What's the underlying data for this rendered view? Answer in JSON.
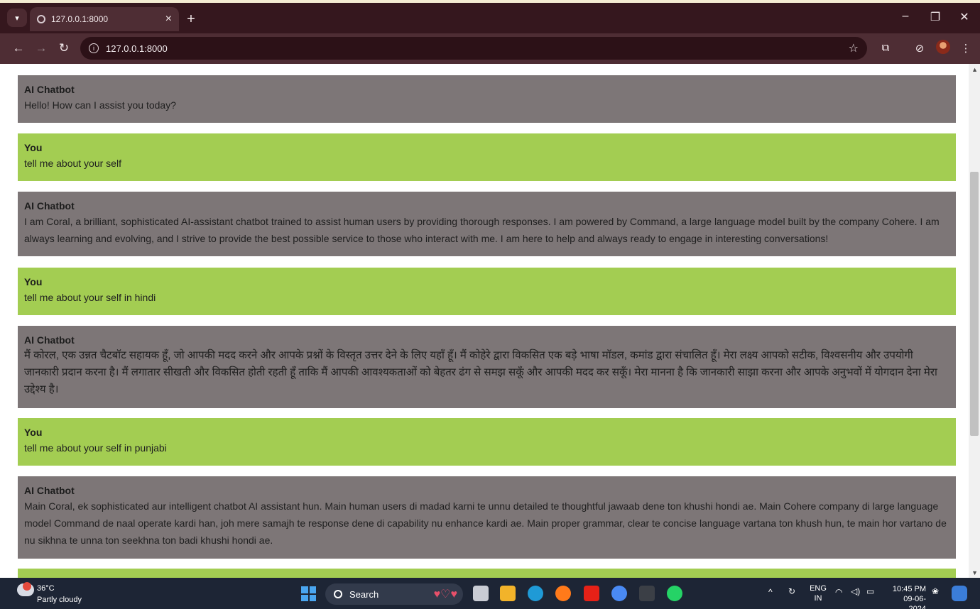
{
  "browser": {
    "tab_title": "127.0.0.1:8000",
    "url": "127.0.0.1:8000",
    "tab_close": "×",
    "new_tab": "+"
  },
  "chat": {
    "messages": [
      {
        "sender": "AI Chatbot",
        "role": "bot",
        "text": "Hello! How can I assist you today?"
      },
      {
        "sender": "You",
        "role": "user",
        "text": "tell me about your self"
      },
      {
        "sender": "AI Chatbot",
        "role": "bot",
        "text": "I am Coral, a brilliant, sophisticated AI-assistant chatbot trained to assist human users by providing thorough responses. I am powered by Command, a large language model built by the company Cohere. I am always learning and evolving, and I strive to provide the best possible service to those who interact with me. I am here to help and always ready to engage in interesting conversations!"
      },
      {
        "sender": "You",
        "role": "user",
        "text": "tell me about your self in hindi"
      },
      {
        "sender": "AI Chatbot",
        "role": "bot",
        "text": "मैं कोरल, एक उन्नत चैटबॉट सहायक हूँ, जो आपकी मदद करने और आपके प्रश्नों के विस्तृत उत्तर देने के लिए यहाँ हूँ। मैं कोहेरे द्वारा विकसित एक बड़े भाषा मॉडल, कमांड द्वारा संचालित हूँ। मेरा लक्ष्य आपको सटीक, विश्वसनीय और उपयोगी जानकारी प्रदान करना है। मैं लगातार सीखती और विकसित होती रहती हूँ ताकि मैं आपकी आवश्यकताओं को बेहतर ढंग से समझ सकूँ और आपकी मदद कर सकूँ। मेरा मानना है कि जानकारी साझा करना और आपके अनुभवों में योगदान देना मेरा उद्देश्य है।"
      },
      {
        "sender": "You",
        "role": "user",
        "text": "tell me about your self in punjabi"
      },
      {
        "sender": "AI Chatbot",
        "role": "bot",
        "text": "Main Coral, ek sophisticated aur intelligent chatbot AI assistant hun. Main human users di madad karni te unnu detailed te thoughtful jawaab dene ton khushi hondi ae. Main Cohere company di large language model Command de naal operate kardi han, joh mere samajh te response dene di capability nu enhance kardi ae. Main proper grammar, clear te concise language vartana ton khush hun, te main hor vartano de nu sikhna te unna ton seekhna ton badi khushi hondi ae."
      }
    ]
  },
  "taskbar": {
    "temperature": "36°C",
    "condition": "Partly cloudy",
    "search_label": "Search",
    "lang_top": "ENG",
    "lang_bottom": "IN",
    "time": "10:45 PM",
    "date": "09-06-2024"
  },
  "colors": {
    "bot_bubble": "#7d7677",
    "user_bubble": "#a3cd52",
    "chrome": "#35171e"
  }
}
